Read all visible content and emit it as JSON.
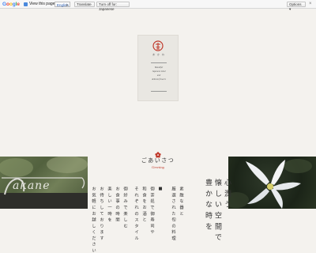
{
  "translate_bar": {
    "logo": [
      "G",
      "o",
      "o",
      "g",
      "l",
      "e"
    ],
    "view_text": "View this page in:",
    "language": "English",
    "translate_button": "Translate",
    "turn_off_button": "Turn off for: Japanese",
    "options_button": "Options ▾",
    "close": "×"
  },
  "logo_card": {
    "brand_jp": "あ か ね",
    "tagline": [
      "Beautiful",
      "Japanese mind",
      "and",
      "delicate flowers"
    ]
  },
  "greeting": {
    "title_jp": "ごあいさつ",
    "title_en": "Greeting"
  },
  "photos": {
    "left_sign": "akane"
  },
  "headline_lines": [
    "心 潤 う",
    "懐 し い 空 間 で",
    "豊 か な 時 を"
  ],
  "body_lines": [
    "素 敵 な 器 と",
    "厳 選 さ れ た 旬 の 料 理",
    "■",
    "御 茶 処 で 御 寿 司 や",
    "和 食 を お 酒 と",
    "そ れ ぞ れ の ス タ イ ル",
    "御 好 み で 楽 し む",
    "お 食 事 の 時 間",
    "楽 し い 一 時 を",
    "お 待 ち し て お り ま す",
    "お 気 軽 に お 越 し く だ さ い"
  ],
  "colors": {
    "accent": "#c0392b",
    "background": "#f4f2ee"
  }
}
